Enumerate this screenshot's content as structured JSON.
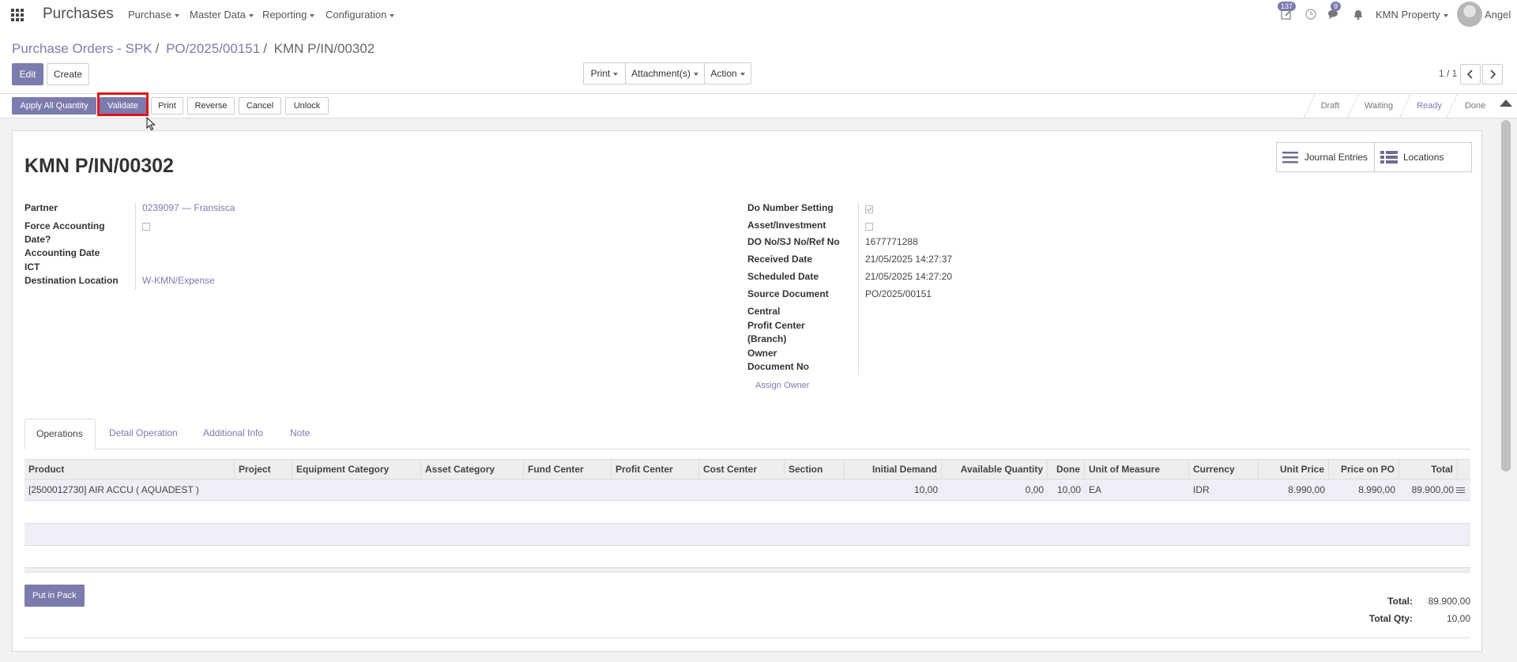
{
  "navbar": {
    "app_name": "Purchases",
    "menus": [
      "Purchase",
      "Master Data",
      "Reporting",
      "Configuration"
    ],
    "activity_badge": "137",
    "messages_badge": "9",
    "company": "KMN Property",
    "user": "Angel"
  },
  "breadcrumb": [
    "Purchase Orders - SPK",
    "PO/2025/00151",
    "KMN P/IN/00302"
  ],
  "buttons": {
    "edit": "Edit",
    "create": "Create",
    "print": "Print",
    "attachments": "Attachment(s)",
    "action": "Action"
  },
  "pager": {
    "value": "1 / 1"
  },
  "statusbar": {
    "buttons": [
      "Apply All Quantity",
      "Validate",
      "Print",
      "Reverse",
      "Cancel",
      "Unlock"
    ],
    "stages": [
      "Draft",
      "Waiting",
      "Ready",
      "Done"
    ],
    "active_stage": "Ready"
  },
  "smart_buttons": {
    "journal": "Journal Entries",
    "locations": "Locations"
  },
  "record": {
    "name": "KMN P/IN/00302",
    "left_fields": [
      {
        "label": "Partner",
        "value": "0239097 — Fransisca"
      },
      {
        "label": "Force Accounting Date?",
        "value": ""
      },
      {
        "label": "Accounting Date",
        "value": ""
      },
      {
        "label": "ICT",
        "value": ""
      },
      {
        "label": "Destination Location",
        "value": "W-KMN/Expense"
      }
    ],
    "right_fields": [
      {
        "label": "Do Number Setting",
        "value": ""
      },
      {
        "label": "Asset/Investment",
        "value": ""
      },
      {
        "label": "DO No/SJ No/Ref No",
        "value": "1677771288"
      },
      {
        "label": "Received Date",
        "value": "21/05/2025 14:27:37"
      },
      {
        "label": "Scheduled Date",
        "value": "21/05/2025 14:27:20"
      },
      {
        "label": "Source Document",
        "value": "PO/2025/00151"
      },
      {
        "label": "Central",
        "value": ""
      },
      {
        "label": "Profit Center (Branch)",
        "value": ""
      },
      {
        "label": "Owner",
        "value": ""
      },
      {
        "label": "Document No",
        "value": ""
      }
    ],
    "assign_owner": "Assign Owner"
  },
  "tabs": [
    "Operations",
    "Detail Operation",
    "Additional Info",
    "Note"
  ],
  "table": {
    "headers": [
      "Product",
      "Project",
      "Equipment Category",
      "Asset Category",
      "Fund Center",
      "Profit Center",
      "Cost Center",
      "Section",
      "Initial Demand",
      "Available Quantity",
      "Done",
      "Unit of Measure",
      "Currency",
      "Unit Price",
      "Price on PO",
      "Total"
    ],
    "rows": [
      [
        "[2500012730] AIR ACCU ( AQUADEST )",
        "",
        "",
        "",
        "",
        "",
        "",
        "",
        "10,00",
        "0,00",
        "10,00",
        "EA",
        "IDR",
        "8.990,00",
        "8.990,00",
        "89.900,00"
      ]
    ]
  },
  "footer": {
    "put_in_pack": "Put in Pack",
    "total_label": "Total:",
    "total_value": "89.900,00",
    "total_qty_label": "Total Qty:",
    "total_qty_value": "10,00"
  }
}
